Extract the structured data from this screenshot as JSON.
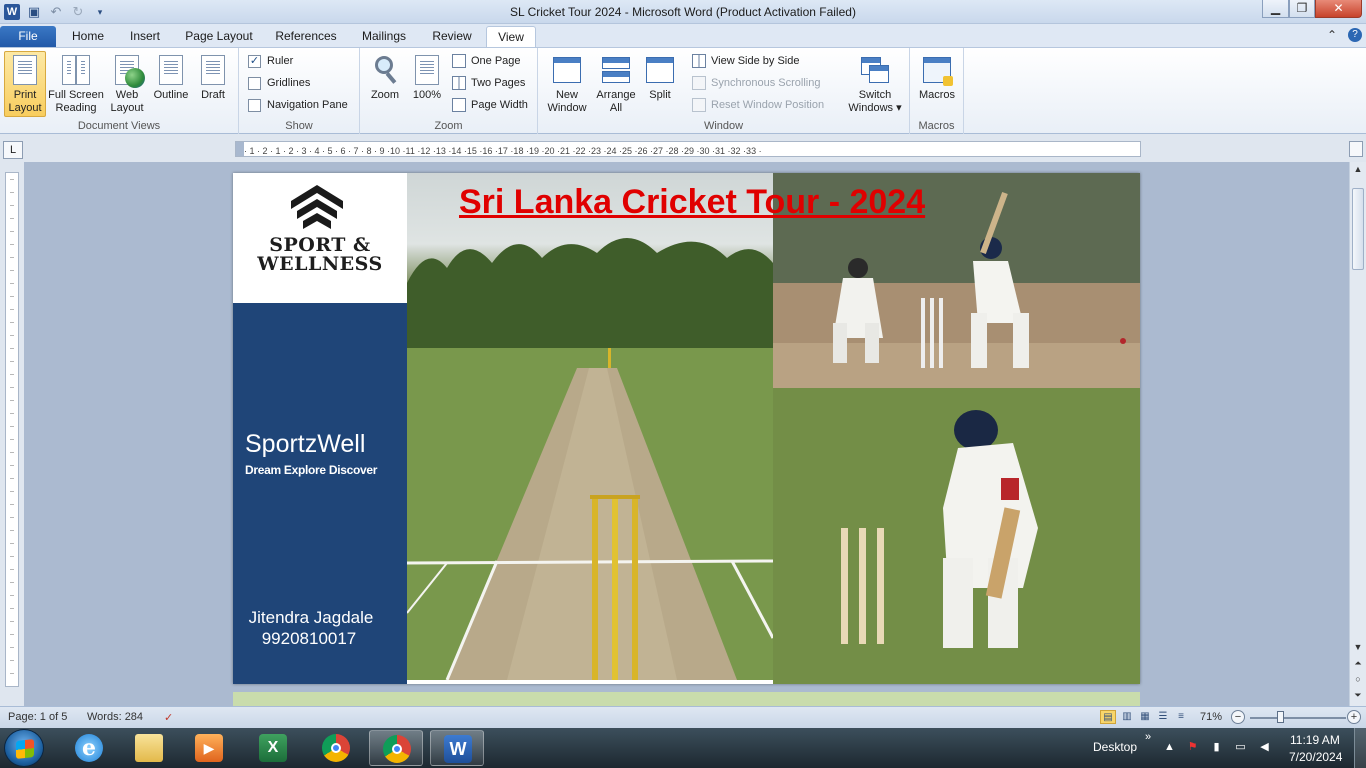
{
  "window": {
    "title": "SL Cricket Tour 2024  -  Microsoft Word (Product Activation Failed)",
    "app_icon": "W",
    "controls": {
      "minimize": "▁",
      "maximize": "❐",
      "close": "✕"
    }
  },
  "quick_access": [
    "save-icon",
    "undo-icon",
    "redo-icon",
    "customize-icon"
  ],
  "tabs": [
    {
      "label": "File"
    },
    {
      "label": "Home"
    },
    {
      "label": "Insert"
    },
    {
      "label": "Page Layout"
    },
    {
      "label": "References"
    },
    {
      "label": "Mailings"
    },
    {
      "label": "Review"
    },
    {
      "label": "View",
      "active": true
    }
  ],
  "ribbon": {
    "document_views": {
      "label": "Document Views",
      "print_layout": "Print Layout",
      "print_layout_1": "Print",
      "print_layout_2": "Layout",
      "full_screen_1": "Full Screen",
      "full_screen_2": "Reading",
      "web_1": "Web",
      "web_2": "Layout",
      "outline": "Outline",
      "draft": "Draft"
    },
    "show": {
      "label": "Show",
      "ruler": "Ruler",
      "ruler_checked": "✓",
      "gridlines": "Gridlines",
      "nav_pane": "Navigation Pane"
    },
    "zoom": {
      "label": "Zoom",
      "zoom": "Zoom",
      "hundred": "100%",
      "one_page": "One Page",
      "two_pages": "Two Pages",
      "page_width": "Page Width"
    },
    "window": {
      "label": "Window",
      "new_1": "New",
      "new_2": "Window",
      "arrange_1": "Arrange",
      "arrange_2": "All",
      "split": "Split",
      "side_by_side": "View Side by Side",
      "sync_scroll": "Synchronous Scrolling",
      "reset_pos": "Reset Window Position",
      "switch_1": "Switch",
      "switch_2": "Windows ▾"
    },
    "macros": {
      "label": "Macros",
      "macros": "Macros"
    }
  },
  "ruler": {
    "corner": "L",
    "ticks": "· 1 · 2 · 1 · 2 · 3 · 4 · 5 · 6 · 7 · 8 · 9 ·10 ·11 ·12 ·13 ·14 ·15 ·16 ·17 ·18 ·19 ·20 ·21 ·22 ·23 ·24 ·25 ·26 ·27 ·28 ·29 ·30 ·31 ·32 ·33 ·"
  },
  "document": {
    "title": "Sri Lanka Cricket Tour - 2024",
    "logo_line1": "SPORT &",
    "logo_line2": "WELLNESS",
    "brand": "SportzWell",
    "tagline": "Dream Explore Discover",
    "contact_name": "Jitendra Jagdale",
    "contact_phone": "9920810017",
    "colors": {
      "sidebar": "#1f4578",
      "title": "#e00000"
    }
  },
  "statusbar": {
    "page": "Page: 1 of 5",
    "words": "Words: 284",
    "zoom": "71%",
    "zoom_minus": "−",
    "zoom_plus": "+"
  },
  "taskbar": {
    "apps": [
      "internet-explorer-icon",
      "file-explorer-icon",
      "media-player-icon",
      "excel-icon",
      "chrome-icon",
      "chrome-running-icon",
      "word-running-icon"
    ],
    "desktop": "Desktop",
    "chevron": "»",
    "time": "11:19 AM",
    "date": "7/20/2024"
  }
}
